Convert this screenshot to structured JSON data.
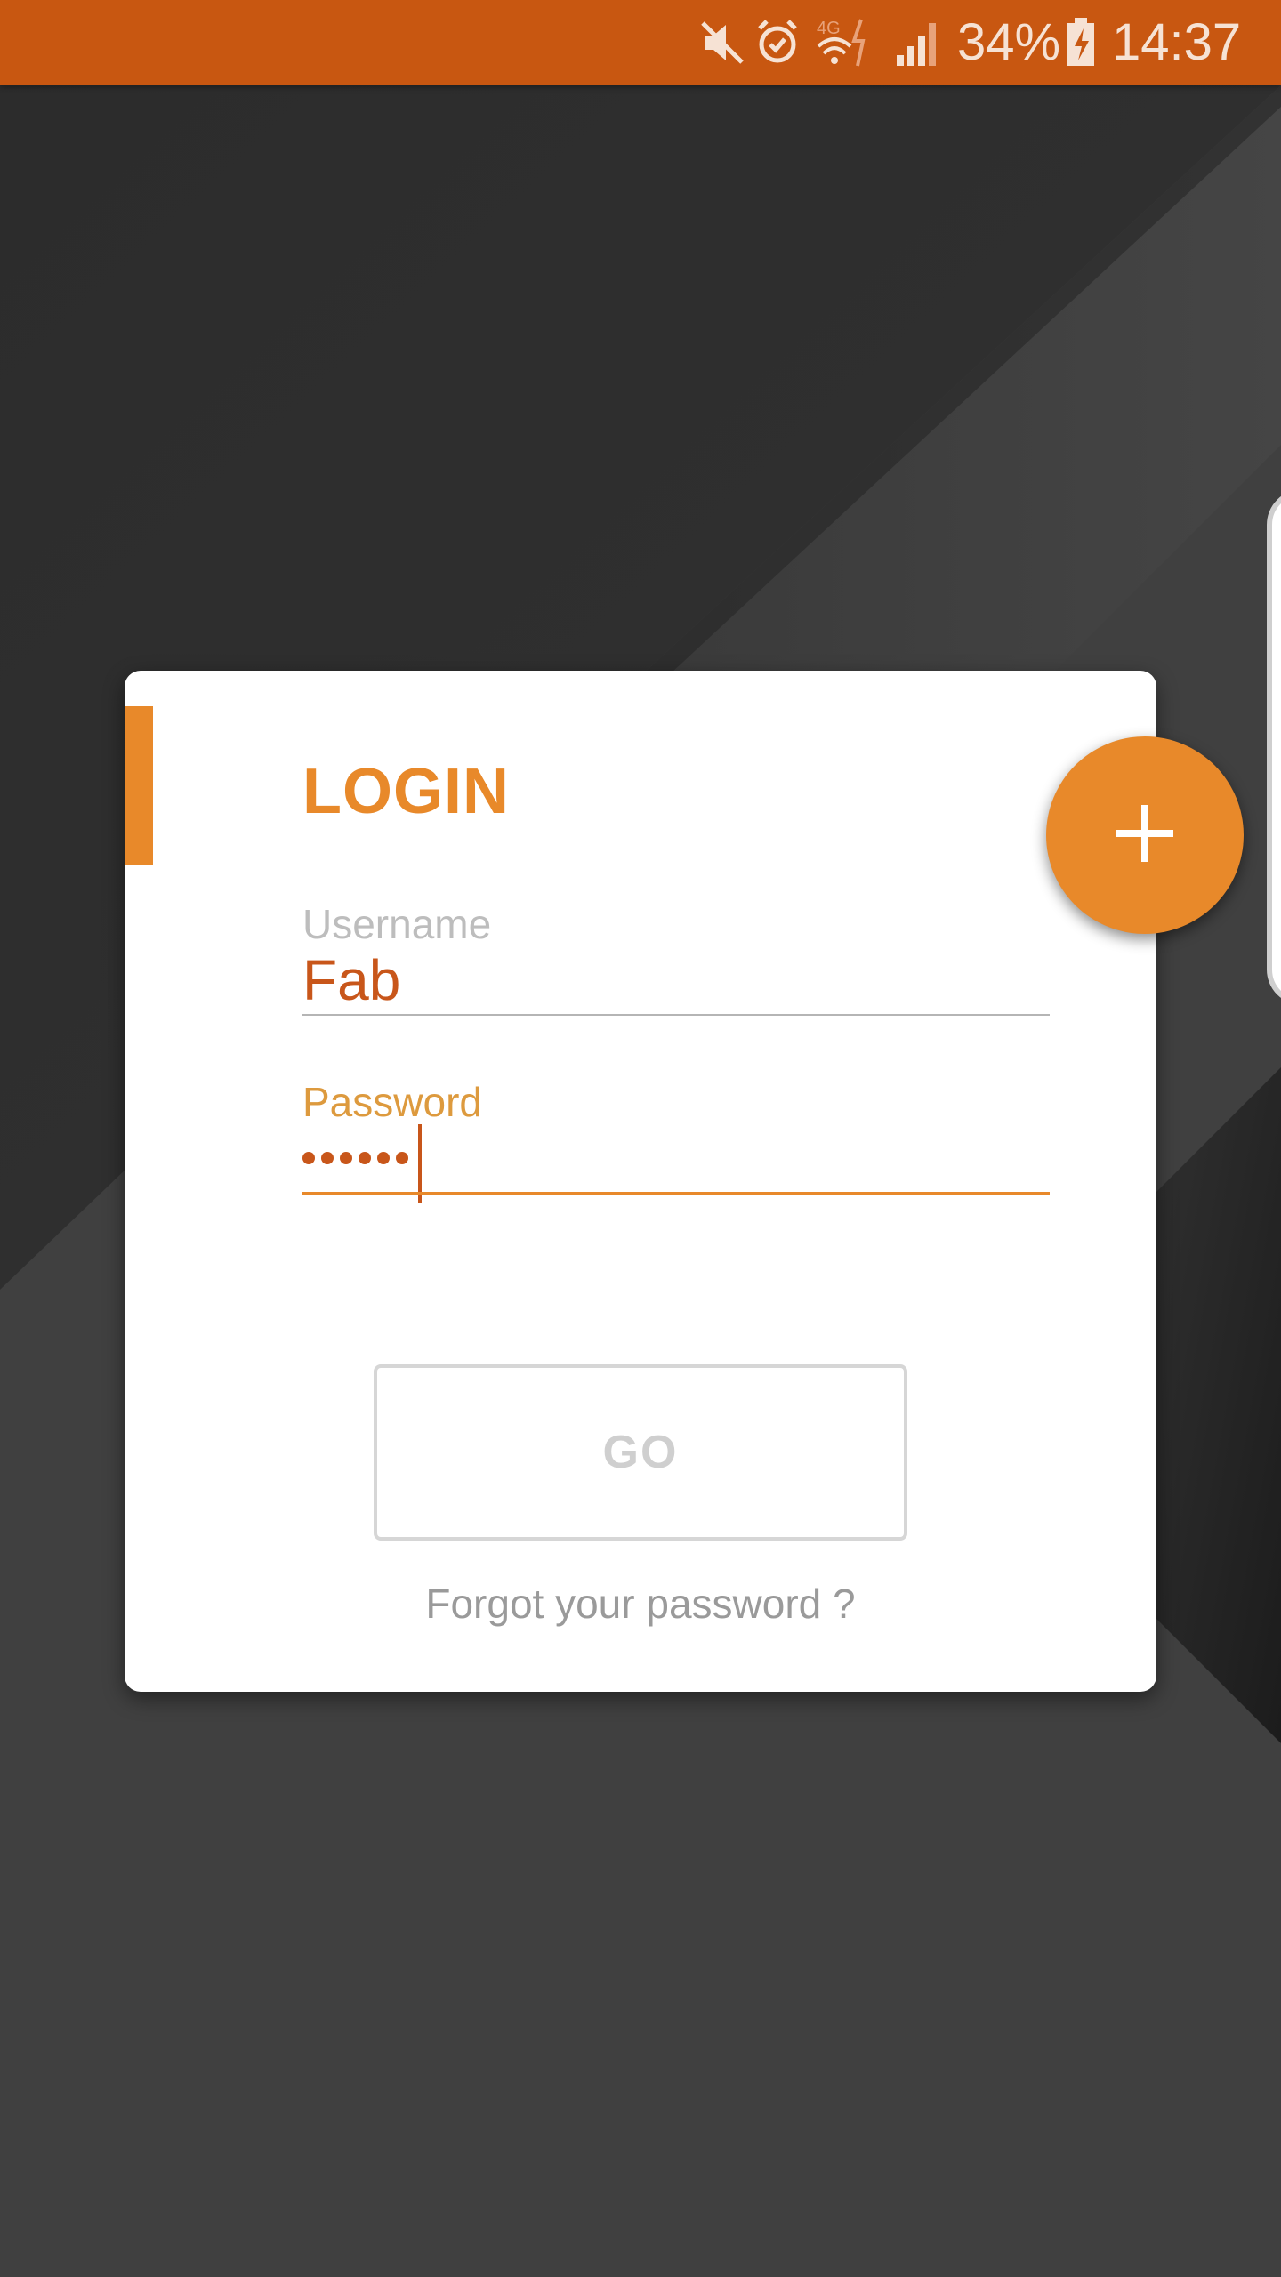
{
  "status_bar": {
    "battery_percent": "34%",
    "time": "14:37",
    "network_label": "4G",
    "icons": [
      "mute-icon",
      "alarm-icon",
      "wifi-4g-icon",
      "signal-icon",
      "battery-charging-icon"
    ]
  },
  "login": {
    "title": "LOGIN",
    "username_label": "Username",
    "username_value": "Fab",
    "password_label": "Password",
    "password_mask_length": 6,
    "go_label": "GO",
    "forgot_label": "Forgot your password ?"
  },
  "fab": {
    "icon": "plus-icon"
  },
  "colors": {
    "status_bar": "#c85711",
    "accent": "#e8892a",
    "input_text": "#c8561a",
    "background": "#3f3f3f"
  }
}
